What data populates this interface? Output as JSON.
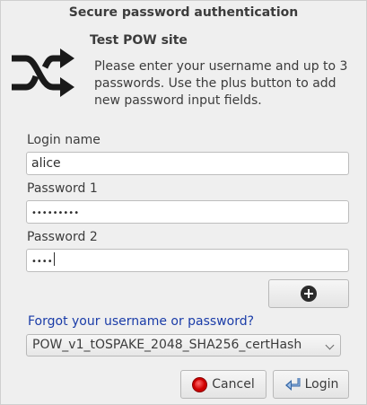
{
  "window": {
    "title": "Secure password authentication"
  },
  "header": {
    "icon": "shuffle-icon",
    "site_name": "Test POW site",
    "instructions": "Please enter your username and up to 3 passwords. Use the plus button to add new password input fields."
  },
  "form": {
    "login_name": {
      "label": "Login name",
      "value": "alice"
    },
    "password1": {
      "label": "Password 1",
      "value": "•••••••••"
    },
    "password2": {
      "label": "Password 2",
      "value": "••••"
    },
    "add_password_icon": "plus-circle-icon",
    "forgot_link": "Forgot your username or password?",
    "protocol_select": {
      "selected": "POW_v1_tOSPAKE_2048_SHA256_certHash"
    }
  },
  "buttons": {
    "cancel": {
      "label": "Cancel",
      "icon": "stop-icon"
    },
    "login": {
      "label": "Login",
      "icon": "login-arrow-icon"
    }
  },
  "colors": {
    "link": "#1a3ca8",
    "background": "#efefef",
    "cancel_icon": "#cc0000",
    "login_icon": "#3465a4"
  }
}
